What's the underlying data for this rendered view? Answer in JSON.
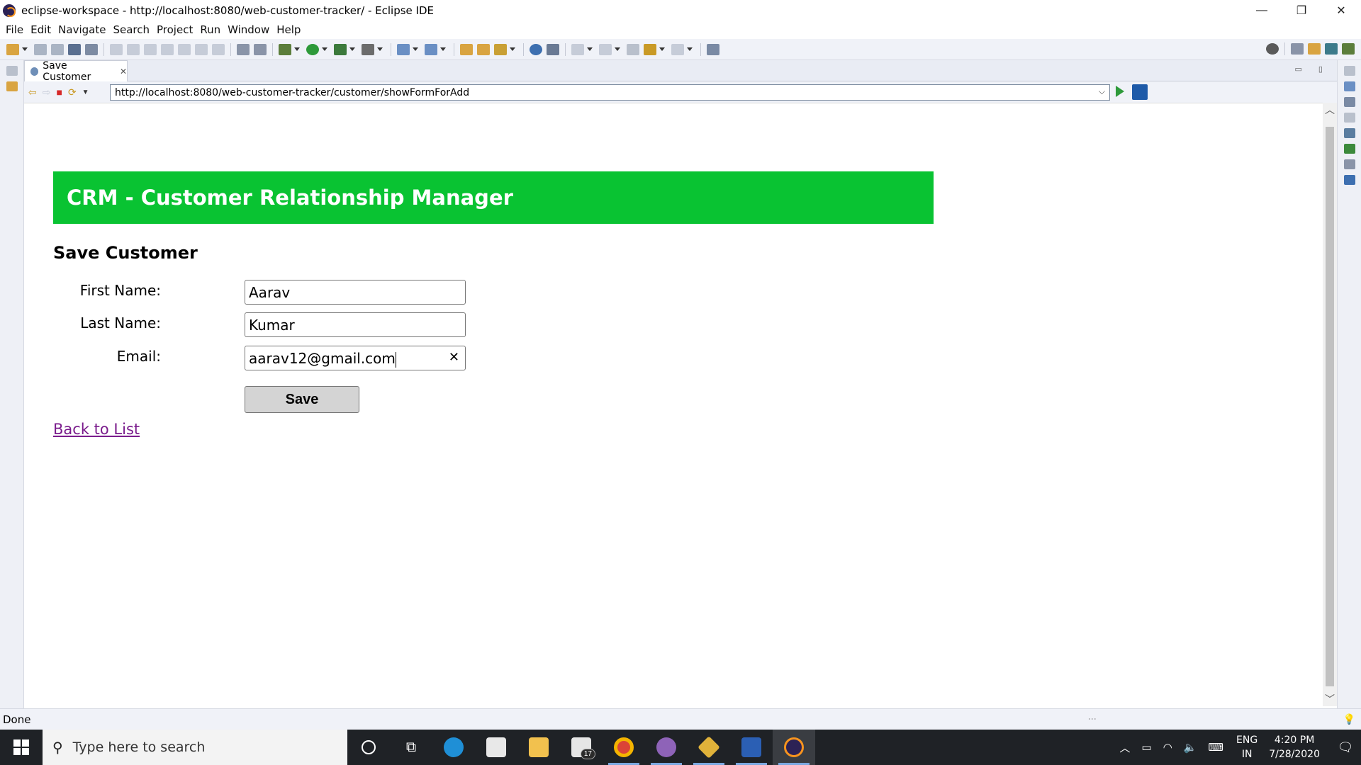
{
  "window": {
    "title": "eclipse-workspace - http://localhost:8080/web-customer-tracker/ - Eclipse IDE",
    "controls": {
      "minimize": "—",
      "restore": "❐",
      "close": "✕"
    }
  },
  "menu": {
    "items": [
      "File",
      "Edit",
      "Navigate",
      "Search",
      "Project",
      "Run",
      "Window",
      "Help"
    ]
  },
  "editor": {
    "tab_label": "Save Customer",
    "tab_close": "✕",
    "url": "http://localhost:8080/web-customer-tracker/customer/showFormForAdd"
  },
  "page": {
    "header_title": "CRM - Customer Relationship Manager",
    "form_title": "Save Customer",
    "first_name_label": "First Name:",
    "first_name_value": "Aarav",
    "last_name_label": "Last Name:",
    "last_name_value": "Kumar",
    "email_label": "Email:",
    "email_value": "aarav12@gmail.com",
    "email_clear": "✕",
    "save_label": "Save",
    "back_link": "Back to List",
    "header_color": "#09c332"
  },
  "status": {
    "text": "Done"
  },
  "taskbar": {
    "search_placeholder": "Type here to search",
    "mail_badge": "17",
    "language": "ENG",
    "region": "IN",
    "time": "4:20 PM",
    "date": "7/28/2020"
  }
}
